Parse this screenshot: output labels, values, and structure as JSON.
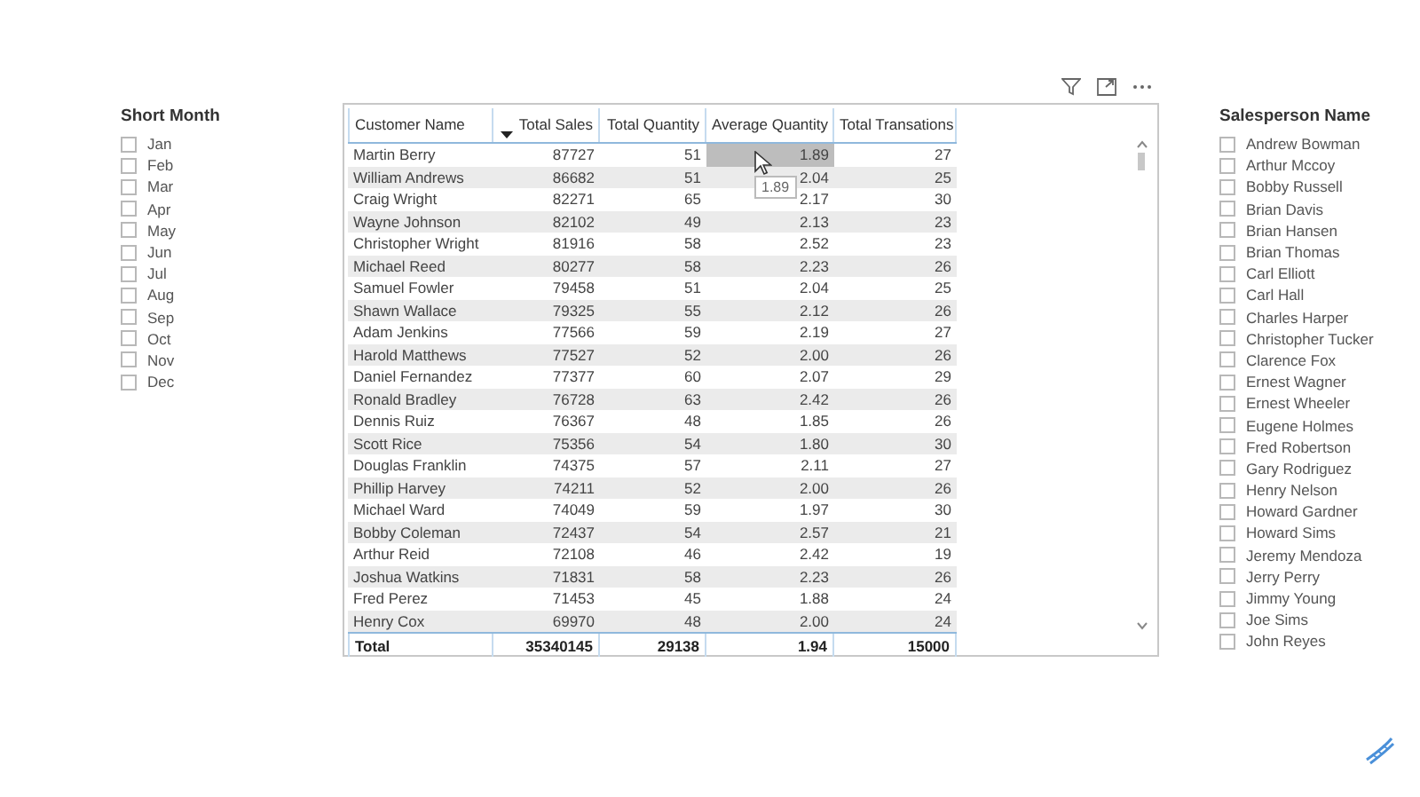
{
  "month_slicer": {
    "title": "Short Month",
    "items": [
      {
        "label": "Jan",
        "checked": false
      },
      {
        "label": "Feb",
        "checked": false
      },
      {
        "label": "Mar",
        "checked": false
      },
      {
        "label": "Apr",
        "checked": false
      },
      {
        "label": "May",
        "checked": false
      },
      {
        "label": "Jun",
        "checked": false
      },
      {
        "label": "Jul",
        "checked": false
      },
      {
        "label": "Aug",
        "checked": false
      },
      {
        "label": "Sep",
        "checked": false
      },
      {
        "label": "Oct",
        "checked": false
      },
      {
        "label": "Nov",
        "checked": false
      },
      {
        "label": "Dec",
        "checked": false
      }
    ]
  },
  "table": {
    "columns": [
      {
        "label": "Customer Name",
        "sorted": false
      },
      {
        "label": "Total Sales",
        "sorted": true
      },
      {
        "label": "Total Quantity",
        "sorted": false
      },
      {
        "label": "Average Quantity",
        "sorted": false
      },
      {
        "label": "Total Transations",
        "sorted": false
      }
    ],
    "rows": [
      {
        "cells": [
          "Martin Berry",
          "87727",
          "51",
          "1.89",
          "27"
        ],
        "cell_selected": [
          false,
          false,
          false,
          true,
          false
        ]
      },
      {
        "cells": [
          "William Andrews",
          "86682",
          "51",
          "2.04",
          "25"
        ],
        "cell_selected": [
          false,
          false,
          false,
          false,
          false
        ]
      },
      {
        "cells": [
          "Craig Wright",
          "82271",
          "65",
          "2.17",
          "30"
        ],
        "cell_selected": [
          false,
          false,
          false,
          false,
          false
        ]
      },
      {
        "cells": [
          "Wayne Johnson",
          "82102",
          "49",
          "2.13",
          "23"
        ],
        "cell_selected": [
          false,
          false,
          false,
          false,
          false
        ]
      },
      {
        "cells": [
          "Christopher Wright",
          "81916",
          "58",
          "2.52",
          "23"
        ],
        "cell_selected": [
          false,
          false,
          false,
          false,
          false
        ]
      },
      {
        "cells": [
          "Michael Reed",
          "80277",
          "58",
          "2.23",
          "26"
        ],
        "cell_selected": [
          false,
          false,
          false,
          false,
          false
        ]
      },
      {
        "cells": [
          "Samuel Fowler",
          "79458",
          "51",
          "2.04",
          "25"
        ],
        "cell_selected": [
          false,
          false,
          false,
          false,
          false
        ]
      },
      {
        "cells": [
          "Shawn Wallace",
          "79325",
          "55",
          "2.12",
          "26"
        ],
        "cell_selected": [
          false,
          false,
          false,
          false,
          false
        ]
      },
      {
        "cells": [
          "Adam Jenkins",
          "77566",
          "59",
          "2.19",
          "27"
        ],
        "cell_selected": [
          false,
          false,
          false,
          false,
          false
        ]
      },
      {
        "cells": [
          "Harold Matthews",
          "77527",
          "52",
          "2.00",
          "26"
        ],
        "cell_selected": [
          false,
          false,
          false,
          false,
          false
        ]
      },
      {
        "cells": [
          "Daniel Fernandez",
          "77377",
          "60",
          "2.07",
          "29"
        ],
        "cell_selected": [
          false,
          false,
          false,
          false,
          false
        ]
      },
      {
        "cells": [
          "Ronald Bradley",
          "76728",
          "63",
          "2.42",
          "26"
        ],
        "cell_selected": [
          false,
          false,
          false,
          false,
          false
        ]
      },
      {
        "cells": [
          "Dennis Ruiz",
          "76367",
          "48",
          "1.85",
          "26"
        ],
        "cell_selected": [
          false,
          false,
          false,
          false,
          false
        ]
      },
      {
        "cells": [
          "Scott Rice",
          "75356",
          "54",
          "1.80",
          "30"
        ],
        "cell_selected": [
          false,
          false,
          false,
          false,
          false
        ]
      },
      {
        "cells": [
          "Douglas Franklin",
          "74375",
          "57",
          "2.11",
          "27"
        ],
        "cell_selected": [
          false,
          false,
          false,
          false,
          false
        ]
      },
      {
        "cells": [
          "Phillip Harvey",
          "74211",
          "52",
          "2.00",
          "26"
        ],
        "cell_selected": [
          false,
          false,
          false,
          false,
          false
        ]
      },
      {
        "cells": [
          "Michael Ward",
          "74049",
          "59",
          "1.97",
          "30"
        ],
        "cell_selected": [
          false,
          false,
          false,
          false,
          false
        ]
      },
      {
        "cells": [
          "Bobby Coleman",
          "72437",
          "54",
          "2.57",
          "21"
        ],
        "cell_selected": [
          false,
          false,
          false,
          false,
          false
        ]
      },
      {
        "cells": [
          "Arthur Reid",
          "72108",
          "46",
          "2.42",
          "19"
        ],
        "cell_selected": [
          false,
          false,
          false,
          false,
          false
        ]
      },
      {
        "cells": [
          "Joshua Watkins",
          "71831",
          "58",
          "2.23",
          "26"
        ],
        "cell_selected": [
          false,
          false,
          false,
          false,
          false
        ]
      },
      {
        "cells": [
          "Fred Perez",
          "71453",
          "45",
          "1.88",
          "24"
        ],
        "cell_selected": [
          false,
          false,
          false,
          false,
          false
        ]
      },
      {
        "cells": [
          "Henry Cox",
          "69970",
          "48",
          "2.00",
          "24"
        ],
        "cell_selected": [
          false,
          false,
          false,
          false,
          false
        ]
      }
    ],
    "total": [
      "Total",
      "35340145",
      "29138",
      "1.94",
      "15000"
    ],
    "tooltip": "1.89"
  },
  "salesperson_slicer": {
    "title": "Salesperson Name",
    "items": [
      {
        "label": "Andrew Bowman",
        "checked": false
      },
      {
        "label": "Arthur Mccoy",
        "checked": false
      },
      {
        "label": "Bobby Russell",
        "checked": false
      },
      {
        "label": "Brian Davis",
        "checked": false
      },
      {
        "label": "Brian Hansen",
        "checked": false
      },
      {
        "label": "Brian Thomas",
        "checked": false
      },
      {
        "label": "Carl Elliott",
        "checked": false
      },
      {
        "label": "Carl Hall",
        "checked": false
      },
      {
        "label": "Charles Harper",
        "checked": false
      },
      {
        "label": "Christopher Tucker",
        "checked": false
      },
      {
        "label": "Clarence Fox",
        "checked": false
      },
      {
        "label": "Ernest Wagner",
        "checked": false
      },
      {
        "label": "Ernest Wheeler",
        "checked": false
      },
      {
        "label": "Eugene Holmes",
        "checked": false
      },
      {
        "label": "Fred Robertson",
        "checked": false
      },
      {
        "label": "Gary Rodriguez",
        "checked": false
      },
      {
        "label": "Henry Nelson",
        "checked": false
      },
      {
        "label": "Howard Gardner",
        "checked": false
      },
      {
        "label": "Howard Sims",
        "checked": false
      },
      {
        "label": "Jeremy Mendoza",
        "checked": false
      },
      {
        "label": "Jerry Perry",
        "checked": false
      },
      {
        "label": "Jimmy Young",
        "checked": false
      },
      {
        "label": "Joe Sims",
        "checked": false
      },
      {
        "label": "John Reyes",
        "checked": false
      }
    ]
  }
}
